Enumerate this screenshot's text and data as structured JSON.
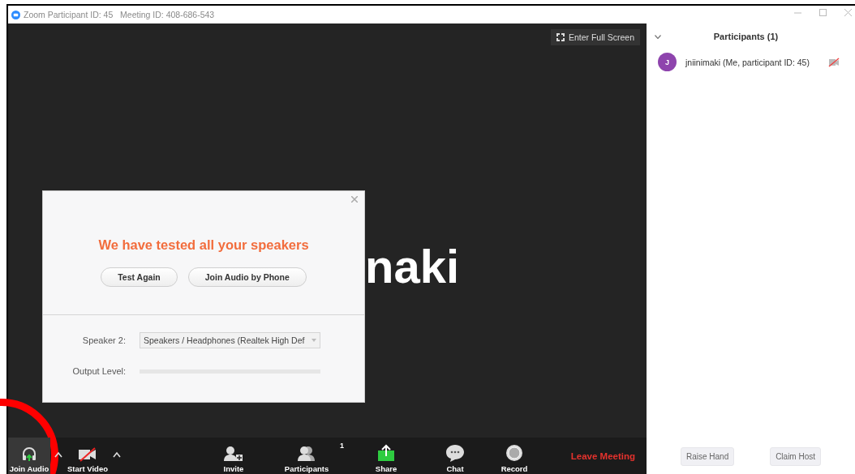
{
  "window": {
    "title": "Zoom Participant ID: 45   Meeting ID: 408-686-543"
  },
  "video": {
    "full_screen_button": "Enter Full Screen",
    "name_partial": "naki"
  },
  "dialog": {
    "heading": "We have tested all your speakers",
    "buttons": [
      "Test Again",
      "Join Audio by Phone"
    ],
    "speaker_label": "Speaker 2:",
    "speaker_value": "Speakers / Headphones (Realtek High Def",
    "output_label": "Output Level:",
    "output_meter": {
      "level": 0.0
    }
  },
  "toolbar": [
    {
      "kind": "audio",
      "label": "Join Audio",
      "selected": true,
      "caret": true
    },
    {
      "kind": "video",
      "label": "Start Video",
      "selected": false,
      "caret": true
    },
    {
      "kind": "invite",
      "label": "Invite",
      "selected": false,
      "caret": false
    },
    {
      "kind": "participants",
      "label": "Participants",
      "badge": "1",
      "selected": false,
      "caret": false
    },
    {
      "kind": "share",
      "label": "Share",
      "selected": false,
      "caret": false
    },
    {
      "kind": "chat",
      "label": "Chat",
      "selected": false,
      "caret": false
    },
    {
      "kind": "record",
      "label": "Record",
      "selected": false,
      "caret": false
    }
  ],
  "leave_button": "Leave Meeting",
  "participants_panel": {
    "title": "Participants (1)",
    "participants": [
      {
        "initial": "J",
        "name": "jniinimaki (Me, participant ID: 45)",
        "color": "#8e44ad",
        "video_off": true
      }
    ],
    "buttons": [
      "Raise Hand",
      "Claim Host"
    ]
  }
}
